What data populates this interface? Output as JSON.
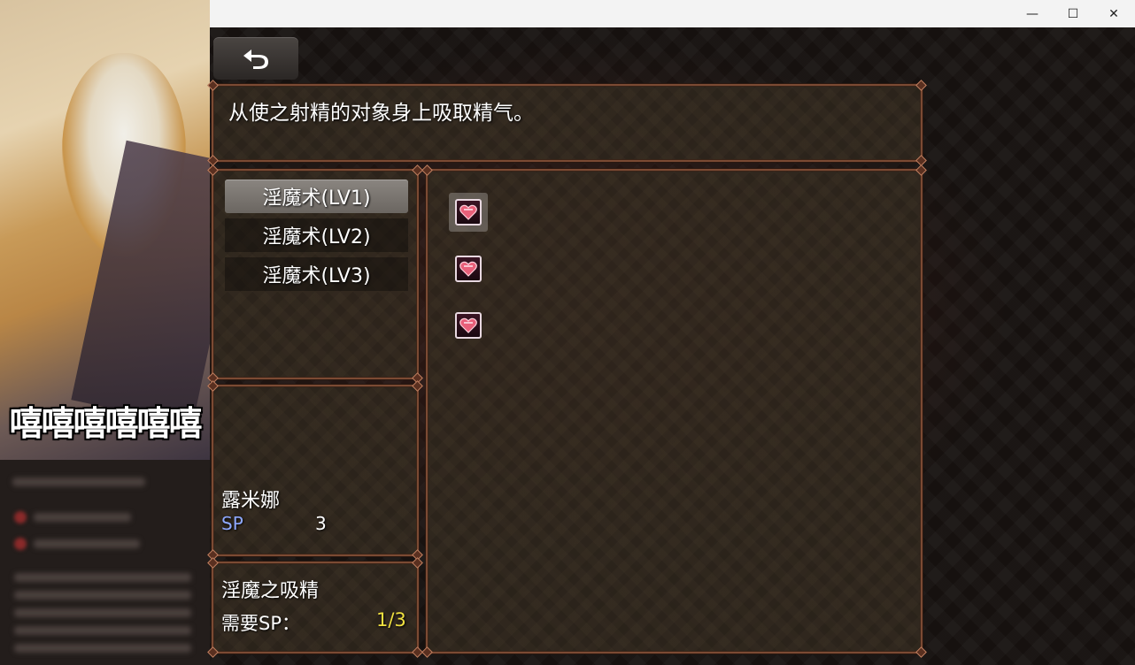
{
  "window": {
    "minimize_glyph": "—",
    "maximize_glyph": "☐",
    "close_glyph": "✕"
  },
  "overlay": {
    "meme_text": "嘻嘻嘻嘻嘻嘻"
  },
  "back_button": {
    "icon": "return-arrow-icon"
  },
  "description": "从使之射精的对象身上吸取精气。",
  "skill_list": [
    {
      "label": "淫魔术(LV1)",
      "selected": true
    },
    {
      "label": "淫魔术(LV2)",
      "selected": false
    },
    {
      "label": "淫魔术(LV3)",
      "selected": false
    }
  ],
  "character": {
    "name": "露米娜",
    "sp_label": "SP",
    "sp_value": "3"
  },
  "skill_detail": {
    "name": "淫魔之吸精",
    "required_label": "需要SP：",
    "required_value": "1/3"
  },
  "skill_tree": {
    "nodes": [
      {
        "icon": "heart-gem-icon",
        "selected": true
      },
      {
        "icon": "heart-gem-icon",
        "selected": false
      },
      {
        "icon": "heart-gem-icon",
        "selected": false
      }
    ]
  },
  "colors": {
    "panel_border": "#7b4a33",
    "sp_label": "#8ea8ff",
    "required_value": "#f0e040",
    "heart": "#e8607a"
  }
}
